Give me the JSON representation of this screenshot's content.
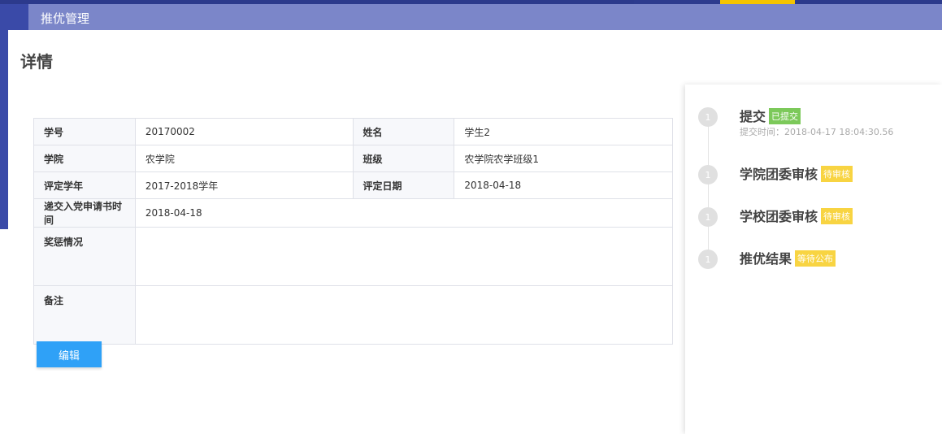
{
  "header": {
    "title": "推优管理"
  },
  "page": {
    "title": "详情"
  },
  "info": {
    "student_id_label": "学号",
    "student_id": "20170002",
    "name_label": "姓名",
    "name": "学生2",
    "college_label": "学院",
    "college": "农学院",
    "class_label": "班级",
    "class": "农学院农学班级1",
    "year_label": "评定学年",
    "year": "2017-2018学年",
    "date_label": "评定日期",
    "date": "2018-04-18",
    "apply_time_label": "递交入党申请书时间",
    "apply_time": "2018-04-18",
    "rewards_label": "奖惩情况",
    "rewards": "",
    "remark_label": "备注",
    "remark": ""
  },
  "actions": {
    "edit_label": "编辑"
  },
  "timeline": [
    {
      "num": "1",
      "name": "提交",
      "badge": "已提交",
      "badge_color": "#7cc95a",
      "time": "提交时间：2018-04-17 18:04:30.56"
    },
    {
      "num": "1",
      "name": "学院团委审核",
      "badge": "待审核",
      "badge_color": "#f8d442"
    },
    {
      "num": "1",
      "name": "学校团委审核",
      "badge": "待审核",
      "badge_color": "#f8d442"
    },
    {
      "num": "1",
      "name": "推优结果",
      "badge": "等待公布",
      "badge_color": "#f8d442"
    }
  ]
}
